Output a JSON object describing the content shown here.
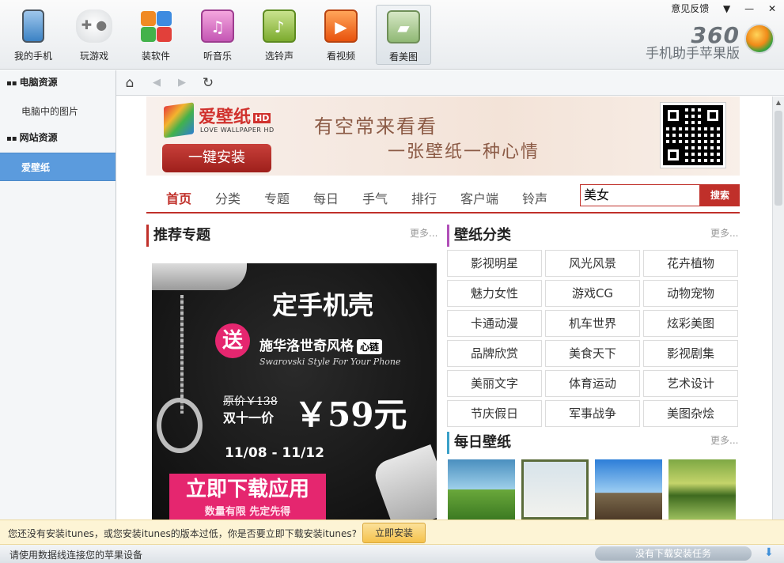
{
  "toolbar": {
    "items": [
      {
        "label": "我的手机",
        "icon": "phone-icon"
      },
      {
        "label": "玩游戏",
        "icon": "gamepad-icon"
      },
      {
        "label": "装软件",
        "icon": "apps-icon"
      },
      {
        "label": "听音乐",
        "icon": "music-icon"
      },
      {
        "label": "选铃声",
        "icon": "bell-icon"
      },
      {
        "label": "看视频",
        "icon": "video-icon"
      },
      {
        "label": "看美图",
        "icon": "pictures-icon"
      }
    ],
    "active": "看美图"
  },
  "window": {
    "feedback": "意见反馈",
    "menu_glyph": "▼",
    "minimize_glyph": "—",
    "close_glyph": "✕",
    "brand_number": "360",
    "brand_text": "手机助手苹果版"
  },
  "sidebar": {
    "sections": [
      {
        "title": "电脑资源",
        "items": [
          "电脑中的图片"
        ]
      },
      {
        "title": "网站资源",
        "items": [
          "爱壁纸"
        ]
      }
    ],
    "active_item": "爱壁纸"
  },
  "nav": {
    "home_glyph": "⌂",
    "back_glyph": "◀",
    "forward_glyph": "▶",
    "refresh_glyph": "↻"
  },
  "site": {
    "brand": "爱壁纸",
    "brand_badge": "HD",
    "brand_sub": "LOVE WALLPAPER HD",
    "install_button": "一键安装",
    "slogan1": "有空常来看看",
    "slogan2": "一张壁纸一种心情",
    "nav_links": [
      "首页",
      "分类",
      "专题",
      "每日",
      "手气",
      "排行",
      "客户端",
      "铃声"
    ],
    "active_link": "首页",
    "search_value": "美女",
    "search_button": "搜索"
  },
  "sections": {
    "recommend_title": "推荐专题",
    "categories_title": "壁纸分类",
    "daily_title": "每日壁纸",
    "more": "更多..."
  },
  "promo": {
    "title": "定手机壳",
    "send": "送",
    "style": "施华洛世奇风格",
    "tag": "心链",
    "italic": "Swarovski Style For Your Phone",
    "old_price": "原价￥138",
    "deal_label": "双十一价",
    "price": "￥59元",
    "dates": "11/08 - 11/12",
    "download": "立即下载应用",
    "limited": "数量有限  先定先得"
  },
  "categories": [
    "影视明星",
    "风光风景",
    "花卉植物",
    "魅力女性",
    "游戏CG",
    "动物宠物",
    "卡通动漫",
    "机车世界",
    "炫彩美图",
    "品牌欣赏",
    "美食天下",
    "影视剧集",
    "美丽文字",
    "体育运动",
    "艺术设计",
    "节庆假日",
    "军事战争",
    "美图杂烩"
  ],
  "itunes": {
    "message": "您还没有安装itunes，或您安装itunes的版本过低，你是否要立即下载安装itunes?",
    "button": "立即安装"
  },
  "status": {
    "text": "请使用数据线连接您的苹果设备",
    "tasks": "没有下载安装任务"
  }
}
